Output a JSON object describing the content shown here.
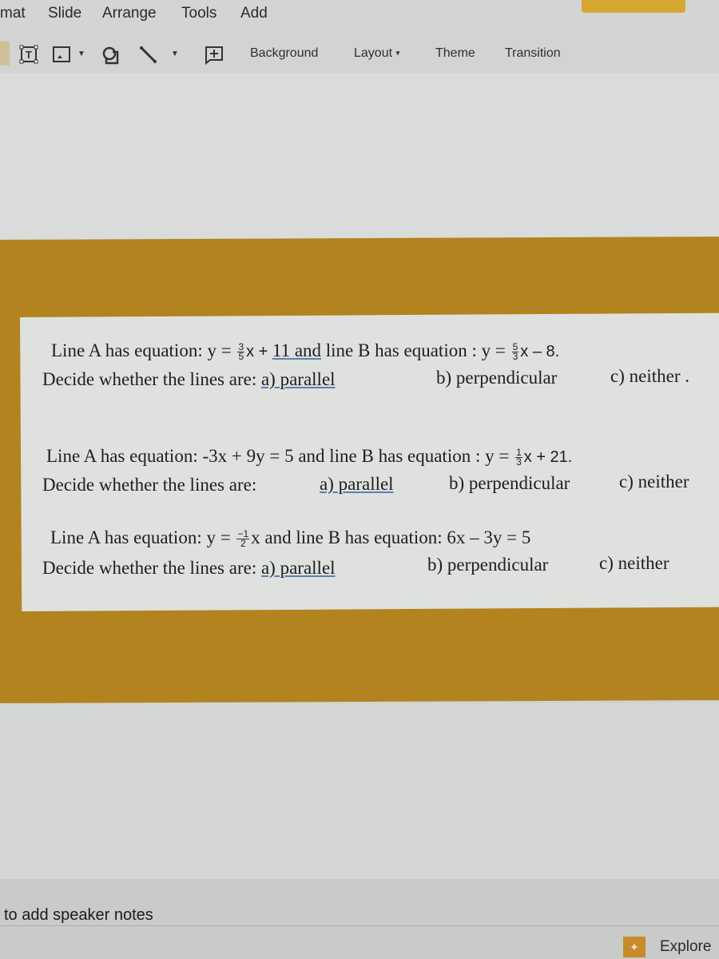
{
  "menubar": {
    "items": [
      "mat",
      "Slide",
      "Arrange",
      "Tools",
      "Add"
    ]
  },
  "toolbar": {
    "icons": [
      "text-box-icon",
      "image-icon",
      "shape-icon",
      "line-icon",
      "comment-add-icon"
    ],
    "buttons": {
      "background": "Background",
      "layout": "Layout",
      "theme": "Theme",
      "transition": "Transition"
    },
    "caret": "▾"
  },
  "slide": {
    "colors": {
      "band": "#b2831f",
      "textbox": "#dee1dd",
      "background": "#d9dcda"
    },
    "questions": [
      {
        "line1": {
          "prefix": "Line A has equation:  y = ",
          "fracA": {
            "num": "3",
            "den": "5"
          },
          "midA": "x + ",
          "underlined": "11  and",
          "mid": " line B has equation :  y  = ",
          "fracB": {
            "num": "5",
            "den": "3"
          },
          "suffix": "x – 8."
        },
        "line2": {
          "prompt": "Decide whether the lines are:  ",
          "opt_a": "a)  parallel",
          "opt_b": "b)  perpendicular",
          "opt_c": "c) neither ."
        }
      },
      {
        "line1": {
          "prefix": "Line A has equation:  -3x + 9y = 5 and line B has equation :  y  = ",
          "fracB": {
            "num": "1",
            "den": "3"
          },
          "suffix": "x  + 21."
        },
        "line2": {
          "prompt": "Decide whether the lines are:",
          "opt_a": "a)  parallel",
          "opt_b": "b)  perpendicular",
          "opt_c": "c) neither"
        }
      },
      {
        "line1": {
          "prefix": "Line A has equation:   y = ",
          "fracA": {
            "num": "−1",
            "den": "2"
          },
          "suffix": "x  and line B has equation:  6x – 3y = 5"
        },
        "line2": {
          "prompt": "Decide whether the lines are: ",
          "opt_a": "a)  parallel",
          "opt_b": "b)  perpendicular",
          "opt_c": "c) neither"
        }
      }
    ]
  },
  "notes": {
    "placeholder": "to add speaker notes"
  },
  "explore": {
    "label": "Explore",
    "icon": "✦"
  }
}
